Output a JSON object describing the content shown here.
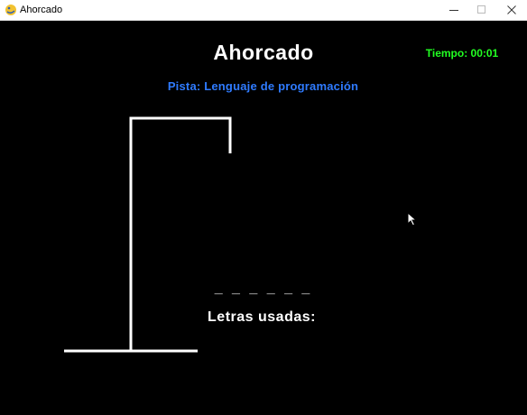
{
  "window": {
    "title": "Ahorcado",
    "icon": "pygame-snake-icon"
  },
  "game": {
    "title": "Ahorcado",
    "timer": "Tiempo: 00:01",
    "hint": "Pista: Lenguaje de programación",
    "word_blanks": "_ _ _ _ _ _",
    "used_letters_label": "Letras usadas:",
    "wrong_guesses": 0
  },
  "colors": {
    "background": "#000000",
    "title_text": "#ffffff",
    "timer_text": "#22ff22",
    "hint_text": "#2f7bff"
  }
}
